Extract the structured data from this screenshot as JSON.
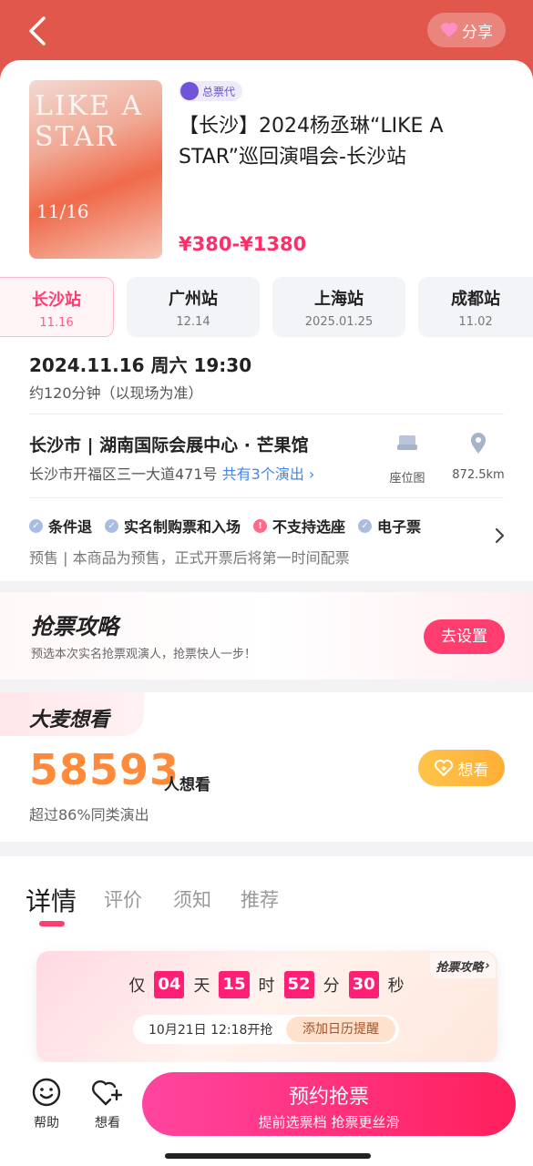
{
  "header": {
    "share_label": "分享"
  },
  "event": {
    "badge": "总票代",
    "title": "【长沙】2024杨丞琳“LIKE A STAR”巡回演唱会-长沙站",
    "price": "¥380-¥1380",
    "poster_text": "LIKE A STAR",
    "poster_date": "11/16"
  },
  "stops": [
    {
      "name": "长沙站",
      "date": "11.16",
      "active": true
    },
    {
      "name": "广州站",
      "date": "12.14"
    },
    {
      "name": "上海站",
      "date": "2025.01.25"
    },
    {
      "name": "成都站",
      "date": "11.02"
    }
  ],
  "schedule": {
    "datetime": "2024.11.16 周六 19:30",
    "duration": "约120分钟（以现场为准）"
  },
  "venue": {
    "name": "长沙市 | 湖南国际会展中心 · 芒果馆",
    "address": "长沙市开福区三一大道471号",
    "shows_link": "共有3个演出",
    "seatmap_label": "座位图",
    "distance": "872.5km"
  },
  "tags": [
    {
      "label": "条件退",
      "type": "ok"
    },
    {
      "label": "实名制购票和入场",
      "type": "ok"
    },
    {
      "label": "不支持选座",
      "type": "warn"
    },
    {
      "label": "电子票",
      "type": "ok"
    }
  ],
  "presale_note": "预售 | 本商品为预售，正式开票后将第一时间配票",
  "strategy": {
    "title": "抢票攻略",
    "subtitle": "预选本次实名抢票观演人，抢票快人一步！",
    "button": "去设置"
  },
  "want": {
    "tag": "大麦想看",
    "count": "58593",
    "unit": "人想看",
    "sub": "超过86%同类演出",
    "button": "想看"
  },
  "tabs": [
    "详情",
    "评价",
    "须知",
    "推荐"
  ],
  "countdown": {
    "link": "抢票攻略",
    "prefix": "仅",
    "days": "04",
    "days_unit": "天",
    "hours": "15",
    "hours_unit": "时",
    "minutes": "52",
    "minutes_unit": "分",
    "seconds": "30",
    "seconds_unit": "秒",
    "start_text": "10月21日 12:18开抢",
    "calendar_button": "添加日历提醒"
  },
  "bottom": {
    "help_label": "帮助",
    "want_label": "想看",
    "buy_main": "预约抢票",
    "buy_sub": "提前选票档 抢票更丝滑"
  },
  "colors": {
    "header": "#e2574c",
    "accent": "#ff3d6e",
    "price": "#ff2d6a",
    "want_count": "#ff8a3a"
  }
}
